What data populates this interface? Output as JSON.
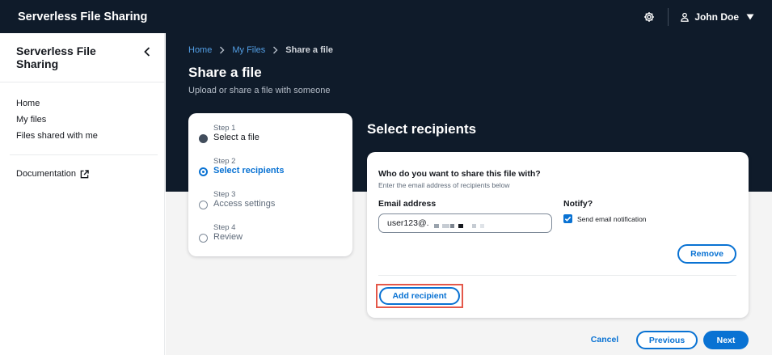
{
  "app": {
    "title": "Serverless File Sharing"
  },
  "topnav": {
    "settings_icon": "gear-icon",
    "user_icon": "user-icon",
    "user_name": "John Doe",
    "caret_icon": "caret-down-icon"
  },
  "sidebar": {
    "title": "Serverless File Sharing",
    "close_icon": "chevron-left-icon",
    "links": [
      {
        "label": "Home"
      },
      {
        "label": "My files"
      },
      {
        "label": "Files shared with me"
      }
    ],
    "documentation": {
      "label": "Documentation",
      "icon": "external-link-icon"
    }
  },
  "breadcrumb": {
    "items": [
      "Home",
      "My Files"
    ],
    "current": "Share a file"
  },
  "page": {
    "title": "Share a file",
    "subtitle": "Upload or share a file with someone"
  },
  "wizard": {
    "steps": [
      {
        "number": "Step 1",
        "label": "Select a file",
        "status": "complete"
      },
      {
        "number": "Step 2",
        "label": "Select recipients",
        "status": "active"
      },
      {
        "number": "Step 3",
        "label": "Access settings",
        "status": "pending"
      },
      {
        "number": "Step 4",
        "label": "Review",
        "status": "pending"
      }
    ]
  },
  "recipients": {
    "section_title": "Select recipients",
    "question": "Who do you want to share this file with?",
    "description": "Enter the email address of recipients below",
    "email_label": "Email address",
    "email_value": "user123@.",
    "notify_label": "Notify?",
    "notify_option": "Send email notification",
    "notify_checked": true,
    "remove_label": "Remove",
    "add_label": "Add recipient"
  },
  "actions": {
    "cancel": "Cancel",
    "previous": "Previous",
    "next": "Next"
  },
  "colors": {
    "header_bg": "#0f1b2a",
    "primary": "#0972d3",
    "link_on_dark": "#539fe5",
    "highlight": "#e4584a"
  }
}
